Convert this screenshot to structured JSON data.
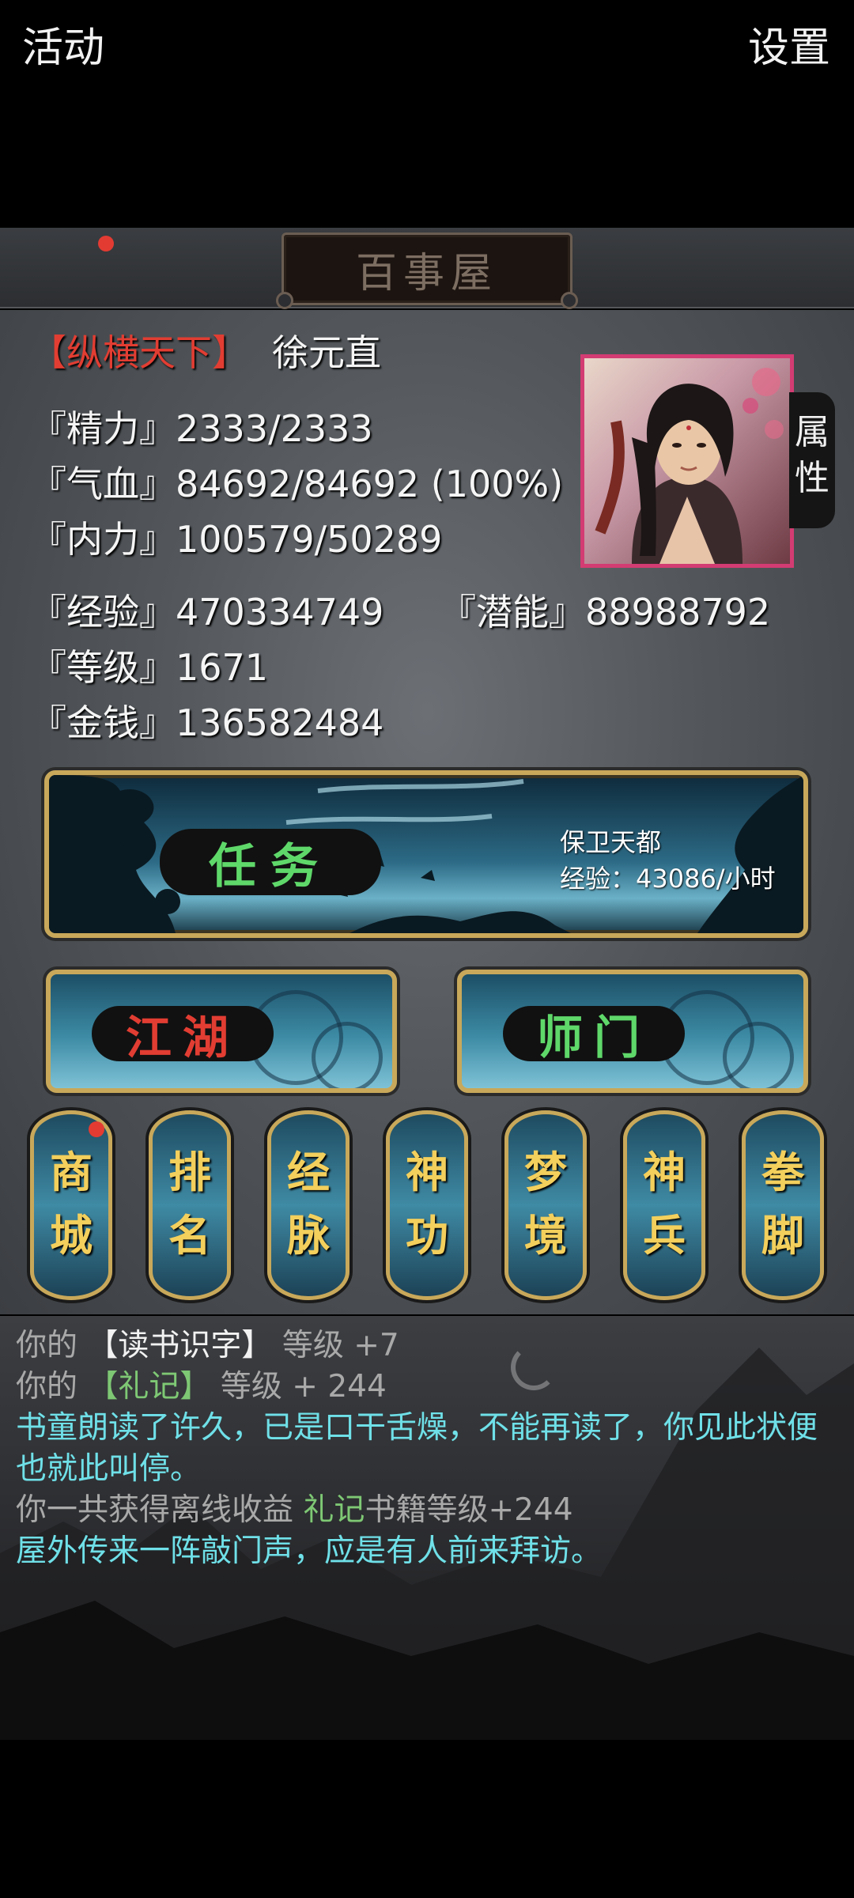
{
  "header": {
    "activity_label": "活动",
    "settings_label": "设置",
    "title": "百事屋"
  },
  "player": {
    "rank_title": "【纵横天下】",
    "name": "徐元直"
  },
  "stats": {
    "jingli": "『精力』2333/2333",
    "qixue": "『气血』84692/84692 (100%)",
    "neili": "『内力』100579/50289",
    "jingyan": "『经验』470334749",
    "qianneng": "『潜能』88988792",
    "dengji": "『等级』1671",
    "jinqian": "『金钱』136582484"
  },
  "attribute_tab": {
    "char1": "属",
    "char2": "性"
  },
  "quest": {
    "label": "任务",
    "name": "保卫天都",
    "exp_rate": "经验：43086/小时"
  },
  "jianghu_label": "江湖",
  "shimen_label": "师门",
  "menu_buttons": [
    {
      "top": "商",
      "bottom": "城"
    },
    {
      "top": "排",
      "bottom": "名"
    },
    {
      "top": "经",
      "bottom": "脉"
    },
    {
      "top": "神",
      "bottom": "功"
    },
    {
      "top": "梦",
      "bottom": "境"
    },
    {
      "top": "神",
      "bottom": "兵"
    },
    {
      "top": "拳",
      "bottom": "脚"
    }
  ],
  "log": {
    "line1_prefix": "你的",
    "line1_book": "【读书识字】",
    "line1_suffix": "等级 +7",
    "line2_prefix": "你的",
    "line2_book": "【礼记】",
    "line2_suffix": "等级 + 244",
    "line3": "书童朗读了许久，已是口干舌燥，不能再读了，你见此状便也就此叫停。",
    "line4_prefix": "你一共获得离线收益",
    "line4_book": "礼记",
    "line4_suffix": "书籍等级+244",
    "line5": "屋外传来一阵敲门声，应是有人前来拜访。"
  },
  "colors": {
    "rank_red": "#e23d32",
    "gold_text": "#f3cf5c",
    "quest_green": "#5fd86a",
    "log_cyan": "#6fe0e8",
    "log_green": "#7ec874"
  }
}
